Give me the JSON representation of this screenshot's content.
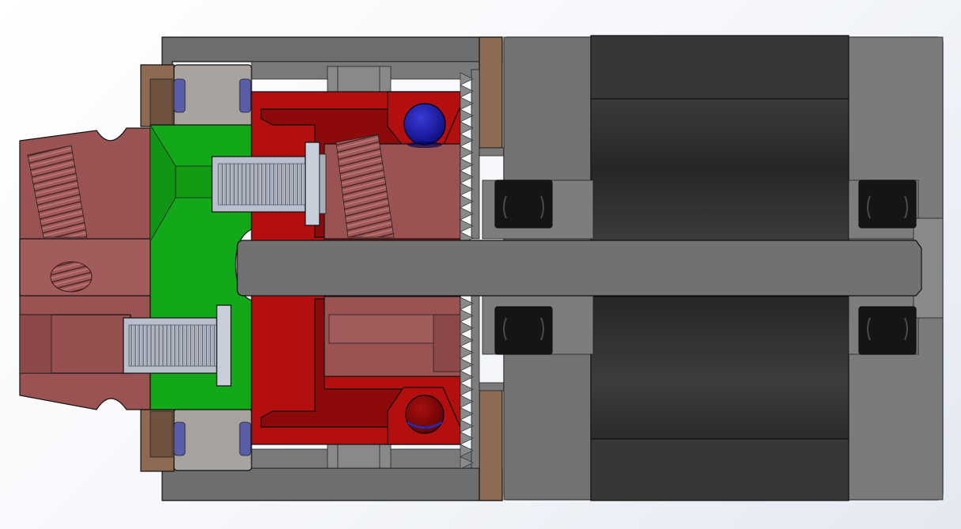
{
  "scene": {
    "kind": "cad-section-view",
    "background": [
      "#ffffff",
      "#e4e8f1"
    ]
  },
  "components": {
    "chuck_body": {
      "color": "#9b5252"
    },
    "adapter_plate": {
      "color": "#13a81a"
    },
    "clutch_hub": {
      "color": "#b30f0f"
    },
    "clutch_hub_dark": {
      "color": "#7a0505"
    },
    "housing": {
      "color": "#6c6c6c"
    },
    "housing_light": {
      "color": "#7c7c7c"
    },
    "bushing": {
      "color": "#a7a39e"
    },
    "spacer_ring": {
      "color": "#8c6a50"
    },
    "o_ring": {
      "color": "#585ea8"
    },
    "shaft": {
      "color": "#717171"
    },
    "bearing": {
      "color": "#121212"
    },
    "motor_core": {
      "color": "#2e2e2e"
    },
    "screw": {
      "color": "#b9bfcc"
    },
    "ball": {
      "color": "#13139c"
    }
  }
}
